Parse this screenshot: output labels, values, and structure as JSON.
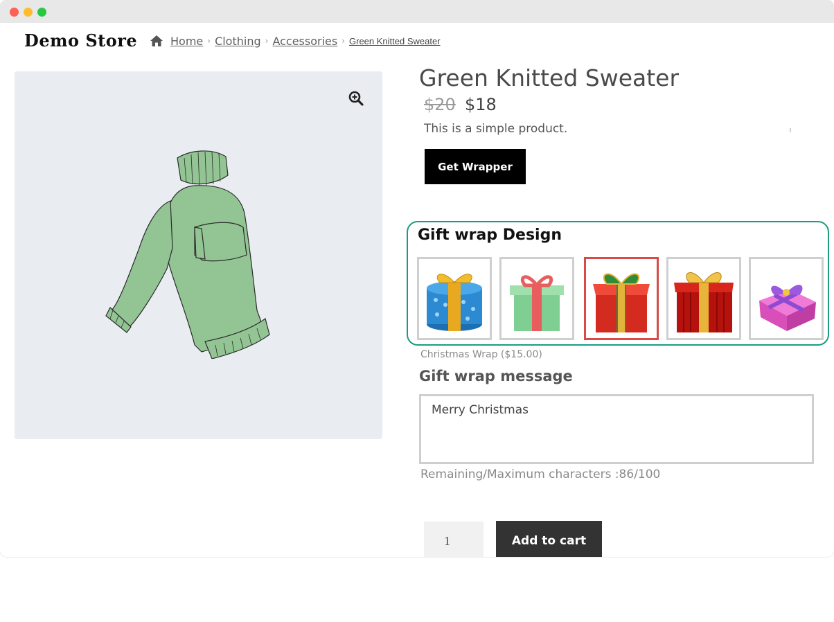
{
  "store": {
    "name": "Demo Store"
  },
  "breadcrumb": {
    "items": [
      "Home",
      "Clothing",
      "Accessories"
    ],
    "current": "Green Knitted Sweater"
  },
  "product": {
    "title": "Green Knitted Sweater",
    "price_old": "$20",
    "price_new": "$18",
    "description": "This is a simple product.",
    "image_icon": "sweater-image",
    "color_accent": "#93c493"
  },
  "actions": {
    "get_wrapper_label": "Get Wrapper",
    "add_to_cart_label": "Add to cart",
    "quantity": "1"
  },
  "gift_wrap": {
    "heading": "Gift wrap Design",
    "options": [
      {
        "icon": "blue-gift-icon",
        "selected": false
      },
      {
        "icon": "green-gift-icon",
        "selected": false
      },
      {
        "icon": "red-gift-icon",
        "selected": true
      },
      {
        "icon": "darkred-gift-icon",
        "selected": false
      },
      {
        "icon": "pink-gift-icon",
        "selected": false
      }
    ],
    "selected_caption": "Christmas Wrap ($15.00)",
    "border_color": "#1a9c83",
    "selected_border_color": "#d94a45"
  },
  "message": {
    "heading": "Gift wrap message",
    "value": "Merry Christmas",
    "remaining": "Remaining/Maximum characters :86/100"
  }
}
